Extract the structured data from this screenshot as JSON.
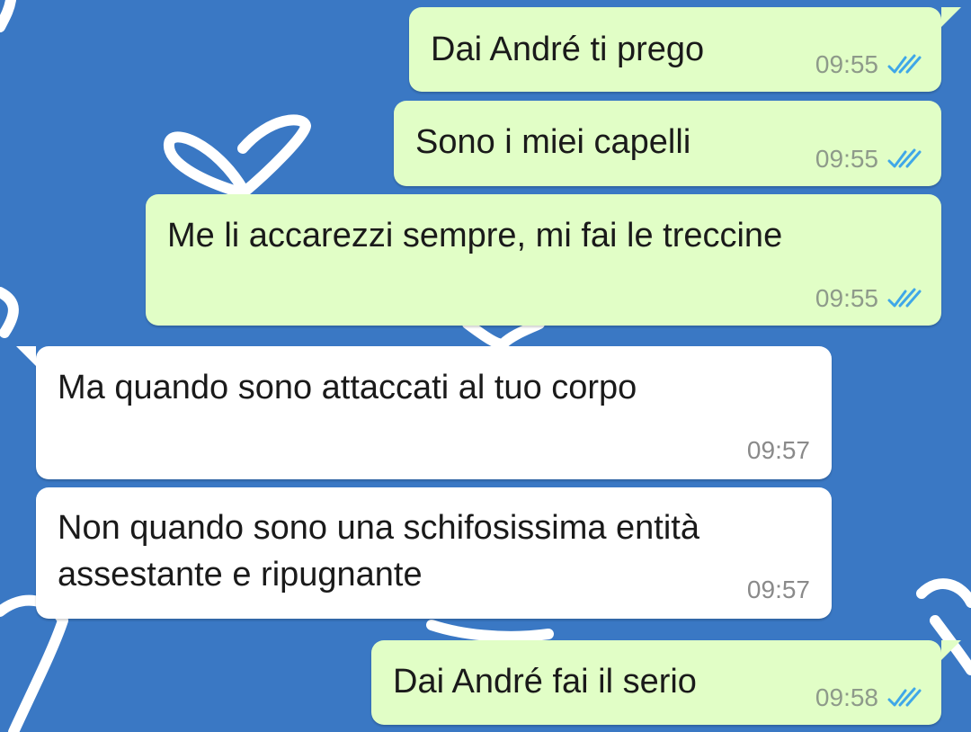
{
  "chat": {
    "wallpaper_color": "#3a78c4",
    "outgoing_color": "#e1fec6",
    "incoming_color": "#ffffff",
    "tick_color": "#3fa7e8",
    "messages": [
      {
        "direction": "outgoing",
        "text": "Dai André ti prego",
        "time": "09:55",
        "status": "read"
      },
      {
        "direction": "outgoing",
        "text": "Sono i miei capelli",
        "time": "09:55",
        "status": "read"
      },
      {
        "direction": "outgoing",
        "text": "Me li accarezzi sempre, mi fai le treccine",
        "time": "09:55",
        "status": "read"
      },
      {
        "direction": "incoming",
        "text": "Ma quando sono attaccati al tuo corpo",
        "time": "09:57"
      },
      {
        "direction": "incoming",
        "text": "Non quando sono una schifosissima entità\nassestante e ripugnante",
        "time": "09:57"
      },
      {
        "direction": "outgoing",
        "text": "Dai André fai il serio",
        "time": "09:58",
        "status": "read"
      }
    ]
  }
}
